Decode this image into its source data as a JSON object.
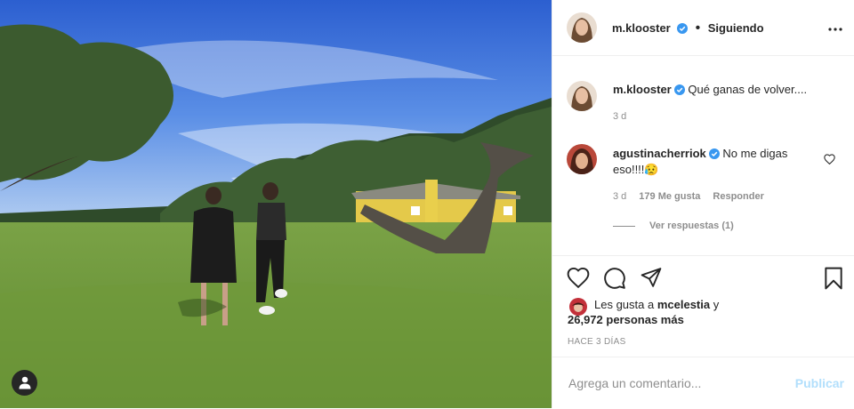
{
  "photo": {
    "alt_icon": "user-tag-icon"
  },
  "header": {
    "username": "m.klooster",
    "dot": "•",
    "follow_status": "Siguiendo",
    "more_icon": "more-horizontal-icon"
  },
  "caption": {
    "username": "m.klooster",
    "text": "Qué ganas de volver....",
    "time": "3 d"
  },
  "comment": {
    "username": "agustinacherriok",
    "text": "No me digas eso!!!!😥",
    "time": "3 d",
    "likes": "179 Me gusta",
    "reply_label": "Responder",
    "view_replies": "Ver respuestas (1)"
  },
  "actions": {
    "icons": [
      "heart-icon",
      "comment-icon",
      "share-icon",
      "bookmark-icon"
    ]
  },
  "likes": {
    "prefix": "Les gusta a ",
    "user": "mcelestia",
    "connector": " y",
    "count": "26,972 personas más"
  },
  "timestamp": "HACE 3 DÍAS",
  "add_comment": {
    "placeholder": "Agrega un comentario...",
    "publish_label": "Publicar"
  },
  "colors": {
    "verified": "#3897f0",
    "publish_disabled": "#b2dffc",
    "muted": "#8e8e8e"
  }
}
